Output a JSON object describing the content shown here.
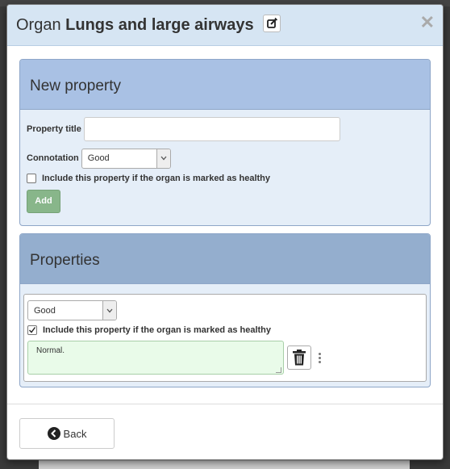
{
  "modal": {
    "title_prefix": "Organ",
    "title_name": "Lungs and large airways"
  },
  "new_property": {
    "heading": "New property",
    "title_label": "Property title",
    "title_value": "",
    "connotation_label": "Connotation",
    "connotation_value": "Good",
    "include_label": "Include this property if the organ is marked as healthy",
    "include_checked": false,
    "add_label": "Add"
  },
  "properties": {
    "heading": "Properties",
    "items": [
      {
        "connotation": "Good",
        "include_label": "Include this property if the organ is marked as healthy",
        "include_checked": true,
        "text": "Normal."
      }
    ]
  },
  "footer": {
    "back_label": "Back"
  },
  "colors": {
    "header_bg": "#d6e5f3",
    "panel_heading": "#a9c1e4",
    "panel_body": "#e5eef8",
    "add_button": "#7fb07f",
    "property_text_bg": "#e9fbe9"
  },
  "icons": [
    "edit-icon",
    "close-icon",
    "chevron-down-icon",
    "check-icon",
    "trash-icon",
    "drag-handle-icon",
    "arrow-left-circle-icon"
  ]
}
